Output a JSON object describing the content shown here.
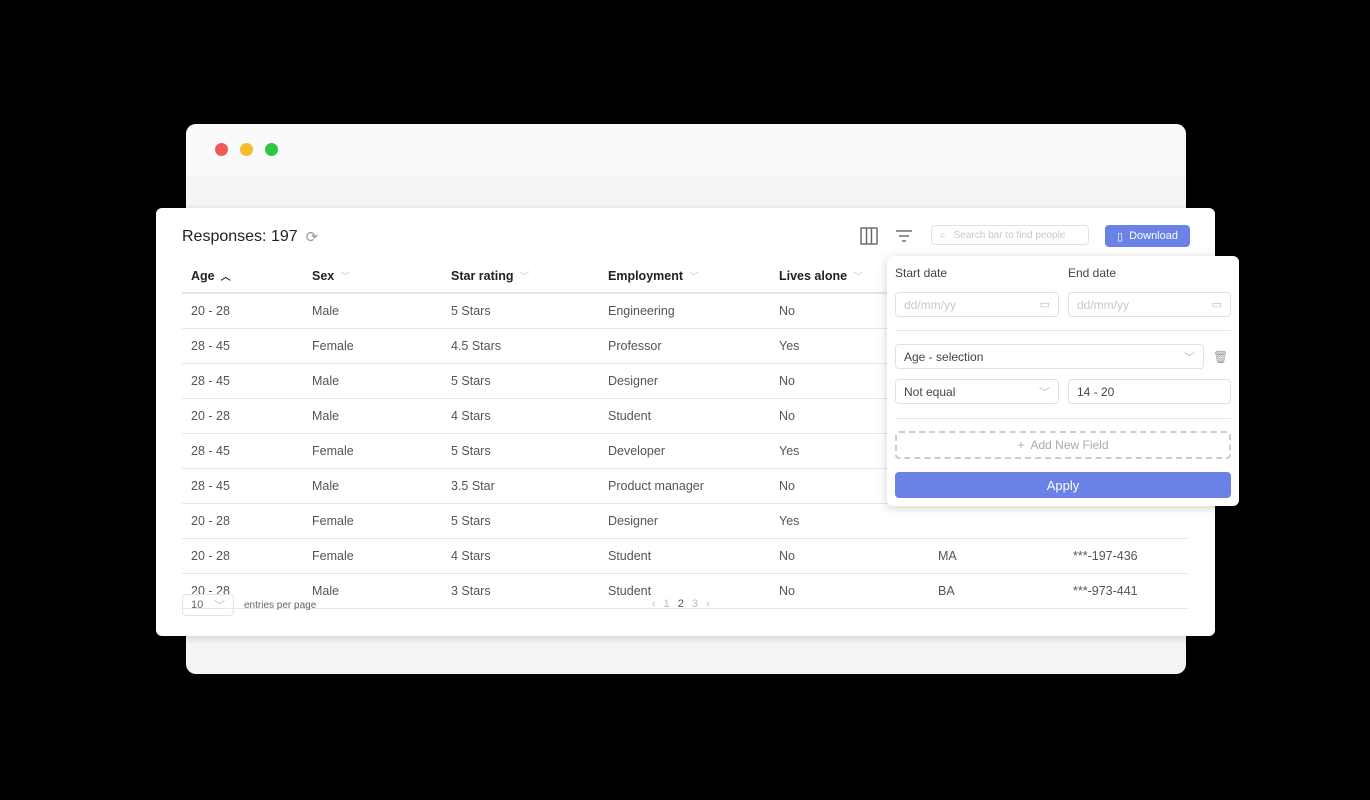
{
  "window": {
    "controls": [
      "close",
      "minimize",
      "maximize"
    ]
  },
  "header": {
    "title": "Responses: 197",
    "search_placeholder": "Search bar to find people",
    "download_label": "Download"
  },
  "table": {
    "columns": [
      {
        "label": "Age",
        "sort": "asc"
      },
      {
        "label": "Sex",
        "sort": "none"
      },
      {
        "label": "Star rating",
        "sort": "none"
      },
      {
        "label": "Employment",
        "sort": "none"
      },
      {
        "label": "Lives alone",
        "sort": "none"
      },
      {
        "label": "",
        "sort": "none"
      },
      {
        "label": "",
        "sort": "none"
      }
    ],
    "rows": [
      [
        "20 - 28",
        "Male",
        "5 Stars",
        "Engineering",
        "No",
        "",
        ""
      ],
      [
        "28 - 45",
        "Female",
        "4.5 Stars",
        "Professor",
        "Yes",
        "",
        ""
      ],
      [
        "28 - 45",
        "Male",
        "5 Stars",
        "Designer",
        "No",
        "",
        ""
      ],
      [
        "20 - 28",
        "Male",
        "4 Stars",
        "Student",
        "No",
        "",
        ""
      ],
      [
        "28 - 45",
        "Female",
        "5 Stars",
        "Developer",
        "Yes",
        "",
        ""
      ],
      [
        "28 - 45",
        "Male",
        "3.5 Star",
        "Product manager",
        "No",
        "",
        ""
      ],
      [
        "20 - 28",
        "Female",
        "5 Stars",
        "Designer",
        "Yes",
        "",
        ""
      ],
      [
        "20 - 28",
        "Female",
        "4 Stars",
        "Student",
        "No",
        "MA",
        "***-197-436"
      ],
      [
        "20 - 28",
        "Male",
        "3 Stars",
        "Student",
        "No",
        "BA",
        "***-973-441"
      ]
    ]
  },
  "footer": {
    "per_page": "10",
    "per_page_label": "entries per page",
    "pages": [
      "1",
      "2",
      "3"
    ],
    "current_page": "2"
  },
  "filter_panel": {
    "start_date_label": "Start date",
    "end_date_label": "End date",
    "date_placeholder": "dd/mm/yy",
    "field_select": "Age - selection",
    "operator_select": "Not equal",
    "value": "14 - 20",
    "add_field_label": "Add New Field",
    "apply_label": "Apply"
  },
  "colors": {
    "accent": "#6a82e6"
  }
}
